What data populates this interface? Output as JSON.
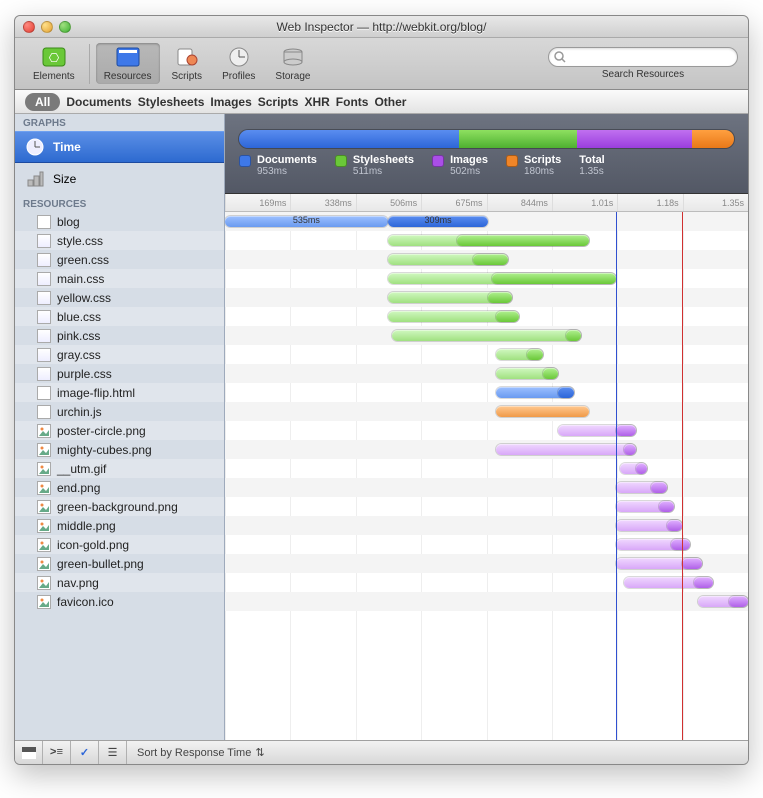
{
  "window": {
    "title": "Web Inspector — http://webkit.org/blog/"
  },
  "toolbar": {
    "items": [
      {
        "label": "Elements"
      },
      {
        "label": "Resources"
      },
      {
        "label": "Scripts"
      },
      {
        "label": "Profiles"
      },
      {
        "label": "Storage"
      }
    ],
    "search_placeholder": "",
    "search_label": "Search Resources"
  },
  "scope": {
    "items": [
      "All",
      "Documents",
      "Stylesheets",
      "Images",
      "Scripts",
      "XHR",
      "Fonts",
      "Other"
    ],
    "selected": "All"
  },
  "sidebar": {
    "graphs_hdr": "GRAPHS",
    "resources_hdr": "RESOURCES",
    "graph_items": [
      {
        "label": "Time",
        "selected": true
      },
      {
        "label": "Size",
        "selected": false
      }
    ],
    "resources": [
      {
        "name": "blog",
        "kind": "doc"
      },
      {
        "name": "style.css",
        "kind": "css"
      },
      {
        "name": "green.css",
        "kind": "css"
      },
      {
        "name": "main.css",
        "kind": "css"
      },
      {
        "name": "yellow.css",
        "kind": "css"
      },
      {
        "name": "blue.css",
        "kind": "css"
      },
      {
        "name": "pink.css",
        "kind": "css"
      },
      {
        "name": "gray.css",
        "kind": "css"
      },
      {
        "name": "purple.css",
        "kind": "css"
      },
      {
        "name": "image-flip.html",
        "kind": "doc"
      },
      {
        "name": "urchin.js",
        "kind": "js"
      },
      {
        "name": "poster-circle.png",
        "kind": "img"
      },
      {
        "name": "mighty-cubes.png",
        "kind": "img"
      },
      {
        "name": "__utm.gif",
        "kind": "img"
      },
      {
        "name": "end.png",
        "kind": "img"
      },
      {
        "name": "green-background.png",
        "kind": "img"
      },
      {
        "name": "middle.png",
        "kind": "img"
      },
      {
        "name": "icon-gold.png",
        "kind": "img"
      },
      {
        "name": "green-bullet.png",
        "kind": "img"
      },
      {
        "name": "nav.png",
        "kind": "img"
      },
      {
        "name": "favicon.ico",
        "kind": "img"
      }
    ]
  },
  "summary": {
    "legend": [
      {
        "label": "Documents",
        "value": "953ms",
        "cls": "d"
      },
      {
        "label": "Stylesheets",
        "value": "511ms",
        "cls": "s"
      },
      {
        "label": "Images",
        "value": "502ms",
        "cls": "i"
      },
      {
        "label": "Scripts",
        "value": "180ms",
        "cls": "j"
      }
    ],
    "total_label": "Total",
    "total_value": "1.35s"
  },
  "ruler": [
    "169ms",
    "338ms",
    "506ms",
    "675ms",
    "844ms",
    "1.01s",
    "1.18s",
    "1.35s"
  ],
  "chart_data": {
    "type": "bar",
    "title": "Resource load timeline",
    "xlabel": "time",
    "x_range_ms": [
      0,
      1350
    ],
    "markers": {
      "blue_ms": 1010,
      "red_ms": 1180
    },
    "category_totals_ms": {
      "Documents": 953,
      "Stylesheets": 511,
      "Images": 502,
      "Scripts": 180
    },
    "rows": [
      {
        "name": "blog",
        "kind": "doc",
        "segments": [
          {
            "start": 0,
            "end": 420,
            "cls": "doc",
            "label": "535ms"
          },
          {
            "start": 420,
            "end": 680,
            "cls": "doc2",
            "label": "309ms"
          }
        ]
      },
      {
        "name": "style.css",
        "kind": "css",
        "segments": [
          {
            "start": 420,
            "end": 940,
            "cls": "cssl"
          },
          {
            "start": 600,
            "end": 940,
            "cls": "css"
          }
        ]
      },
      {
        "name": "green.css",
        "kind": "css",
        "segments": [
          {
            "start": 420,
            "end": 730,
            "cls": "cssl"
          },
          {
            "start": 640,
            "end": 730,
            "cls": "css"
          }
        ]
      },
      {
        "name": "main.css",
        "kind": "css",
        "segments": [
          {
            "start": 420,
            "end": 1010,
            "cls": "cssl"
          },
          {
            "start": 690,
            "end": 1010,
            "cls": "css"
          }
        ]
      },
      {
        "name": "yellow.css",
        "kind": "css",
        "segments": [
          {
            "start": 420,
            "end": 740,
            "cls": "cssl"
          },
          {
            "start": 680,
            "end": 740,
            "cls": "css"
          }
        ]
      },
      {
        "name": "blue.css",
        "kind": "css",
        "segments": [
          {
            "start": 420,
            "end": 760,
            "cls": "cssl"
          },
          {
            "start": 700,
            "end": 760,
            "cls": "css"
          }
        ]
      },
      {
        "name": "pink.css",
        "kind": "css",
        "segments": [
          {
            "start": 430,
            "end": 920,
            "cls": "cssl"
          },
          {
            "start": 880,
            "end": 920,
            "cls": "css"
          }
        ]
      },
      {
        "name": "gray.css",
        "kind": "css",
        "segments": [
          {
            "start": 700,
            "end": 820,
            "cls": "cssl"
          },
          {
            "start": 780,
            "end": 820,
            "cls": "css"
          }
        ]
      },
      {
        "name": "purple.css",
        "kind": "css",
        "segments": [
          {
            "start": 700,
            "end": 860,
            "cls": "cssl"
          },
          {
            "start": 820,
            "end": 860,
            "cls": "css"
          }
        ]
      },
      {
        "name": "image-flip.html",
        "kind": "doc",
        "segments": [
          {
            "start": 700,
            "end": 900,
            "cls": "doc"
          },
          {
            "start": 860,
            "end": 900,
            "cls": "doc2"
          }
        ]
      },
      {
        "name": "urchin.js",
        "kind": "js",
        "segments": [
          {
            "start": 700,
            "end": 940,
            "cls": "js"
          }
        ]
      },
      {
        "name": "poster-circle.png",
        "kind": "img",
        "segments": [
          {
            "start": 860,
            "end": 1060,
            "cls": "imgl"
          },
          {
            "start": 1010,
            "end": 1060,
            "cls": "img"
          }
        ]
      },
      {
        "name": "mighty-cubes.png",
        "kind": "img",
        "segments": [
          {
            "start": 700,
            "end": 1060,
            "cls": "imgl"
          },
          {
            "start": 1030,
            "end": 1060,
            "cls": "img"
          }
        ]
      },
      {
        "name": "__utm.gif",
        "kind": "img",
        "segments": [
          {
            "start": 1020,
            "end": 1090,
            "cls": "imgl"
          },
          {
            "start": 1060,
            "end": 1090,
            "cls": "img"
          }
        ]
      },
      {
        "name": "end.png",
        "kind": "img",
        "segments": [
          {
            "start": 1010,
            "end": 1140,
            "cls": "imgl"
          },
          {
            "start": 1100,
            "end": 1140,
            "cls": "img"
          }
        ]
      },
      {
        "name": "green-background.png",
        "kind": "img",
        "segments": [
          {
            "start": 1010,
            "end": 1160,
            "cls": "imgl"
          },
          {
            "start": 1120,
            "end": 1160,
            "cls": "img"
          }
        ]
      },
      {
        "name": "middle.png",
        "kind": "img",
        "segments": [
          {
            "start": 1010,
            "end": 1180,
            "cls": "imgl"
          },
          {
            "start": 1140,
            "end": 1180,
            "cls": "img"
          }
        ]
      },
      {
        "name": "icon-gold.png",
        "kind": "img",
        "segments": [
          {
            "start": 1010,
            "end": 1200,
            "cls": "imgl"
          },
          {
            "start": 1150,
            "end": 1200,
            "cls": "img"
          }
        ]
      },
      {
        "name": "green-bullet.png",
        "kind": "img",
        "segments": [
          {
            "start": 1010,
            "end": 1230,
            "cls": "imgl"
          },
          {
            "start": 1180,
            "end": 1230,
            "cls": "img"
          }
        ]
      },
      {
        "name": "nav.png",
        "kind": "img",
        "segments": [
          {
            "start": 1030,
            "end": 1260,
            "cls": "imgl"
          },
          {
            "start": 1210,
            "end": 1260,
            "cls": "img"
          }
        ]
      },
      {
        "name": "favicon.ico",
        "kind": "img",
        "segments": [
          {
            "start": 1220,
            "end": 1350,
            "cls": "imgl"
          },
          {
            "start": 1300,
            "end": 1350,
            "cls": "img"
          }
        ]
      }
    ]
  },
  "bottombar": {
    "sort_label": "Sort by Response Time"
  }
}
